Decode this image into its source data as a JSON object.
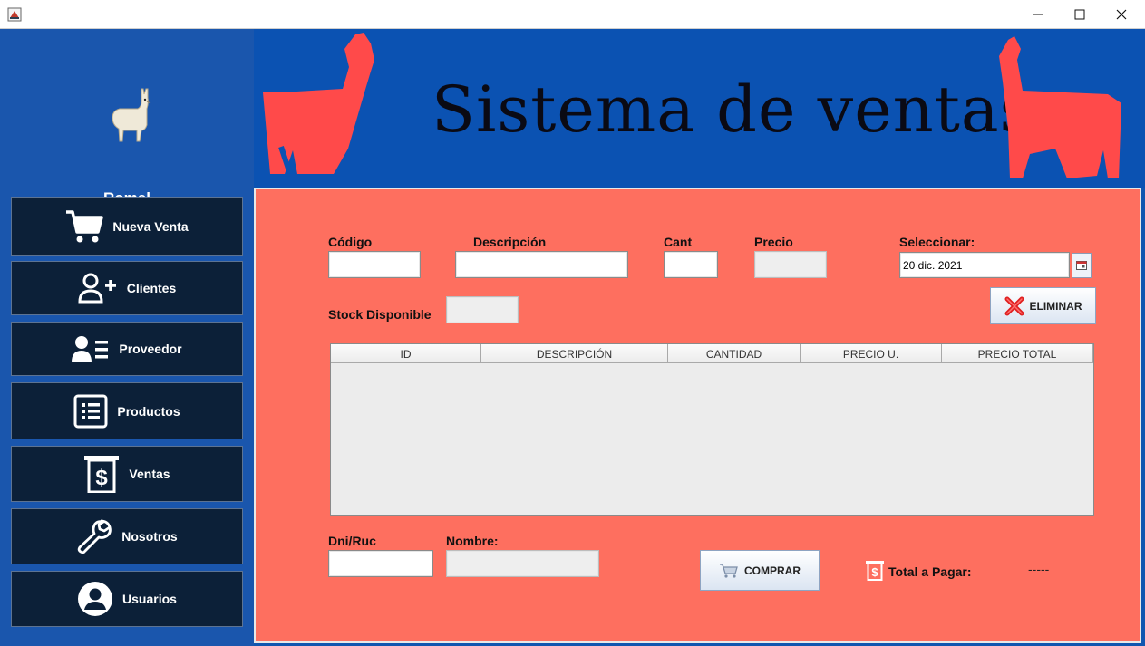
{
  "window": {
    "title": ""
  },
  "sidebar": {
    "user_name": "Romel",
    "items": [
      {
        "label": "Nueva Venta",
        "icon": "cart-icon"
      },
      {
        "label": "Clientes",
        "icon": "add-user-icon"
      },
      {
        "label": "Proveedor",
        "icon": "contact-list-icon"
      },
      {
        "label": "Productos",
        "icon": "list-icon"
      },
      {
        "label": "Ventas",
        "icon": "receipt-dollar-icon"
      },
      {
        "label": "Nosotros",
        "icon": "wrench-icon"
      },
      {
        "label": "Usuarios",
        "icon": "user-circle-icon"
      }
    ]
  },
  "banner": {
    "title": "Sistema de ventas"
  },
  "form": {
    "codigo_label": "Código",
    "codigo_value": "",
    "descripcion_label": "Descripción",
    "descripcion_value": "",
    "cant_label": "Cant",
    "cant_value": "",
    "precio_label": "Precio",
    "precio_value": "",
    "seleccionar_label": "Seleccionar:",
    "date_value": "20 dic. 2021",
    "stock_label": "Stock Disponible",
    "stock_value": "",
    "eliminar_label": "ELIMINAR",
    "dni_label": "Dni/Ruc",
    "dni_value": "",
    "nombre_label": "Nombre:",
    "nombre_value": "",
    "comprar_label": "COMPRAR",
    "total_label": "Total a Pagar:",
    "total_value": "-----"
  },
  "table": {
    "columns": [
      "ID",
      "DESCRIPCIÓN",
      "CANTIDAD",
      "PRECIO U.",
      "PRECIO TOTAL"
    ],
    "rows": []
  },
  "colors": {
    "sidebar_bg": "#1a56ad",
    "nav_button_bg": "#0c2038",
    "banner_bg": "#0b52b2",
    "llama_red": "#ff4a4a",
    "panel_bg": "#fe6f5f"
  }
}
